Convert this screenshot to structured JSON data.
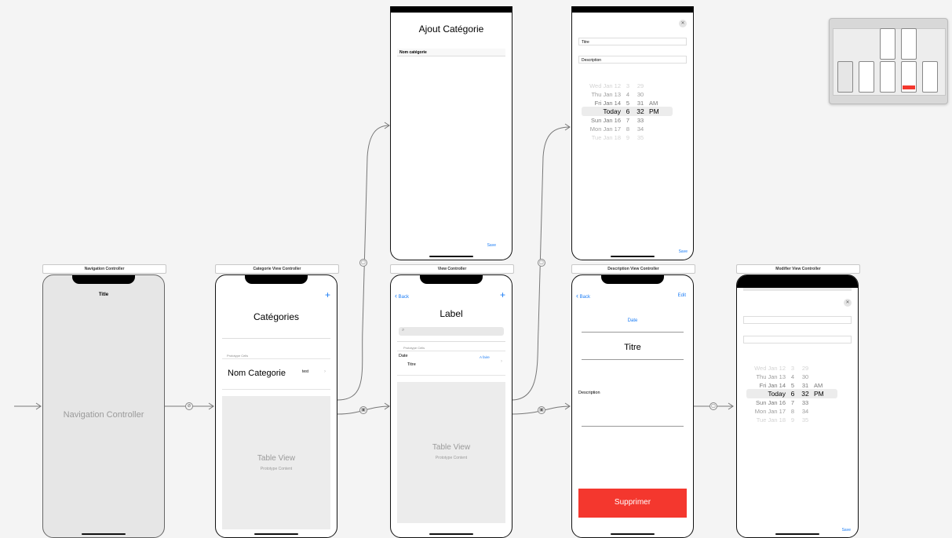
{
  "scenes": {
    "navigation": {
      "label": "Navigation Controller",
      "nav_title": "Title",
      "placeholder": "Navigation Controller"
    },
    "categories": {
      "label": "Categorie View Controller",
      "add": "+",
      "title": "Catégories",
      "prototype_header": "Prototype Cells",
      "cell_title": "Nom Categorie",
      "cell_detail": "test",
      "table_placeholder": "Table View",
      "table_sub": "Prototype Content"
    },
    "add_category": {
      "title": "Ajout Catégorie",
      "field_placeholder": "Nom catégorie",
      "save": "Save"
    },
    "view_controller": {
      "label": "View Controller",
      "back": "Back",
      "add": "+",
      "title": "Label",
      "prototype_header": "Prototype Cells",
      "cell_date": "Date",
      "cell_status": "A faire",
      "cell_title": "Titre",
      "table_placeholder": "Table View",
      "table_sub": "Prototype Content"
    },
    "add_task": {
      "field_title": "Titre",
      "field_description": "Description",
      "save": "Save"
    },
    "description": {
      "label": "Description View Controller",
      "back": "Back",
      "edit": "Edit",
      "date": "Date",
      "title": "Titre",
      "description_label": "Description",
      "delete_button": "Supprimer"
    },
    "modifier": {
      "label": "Modifier View Controller",
      "save": "Save"
    }
  },
  "date_picker": {
    "rows": [
      {
        "day": "Wed Jan 12",
        "hour": "3",
        "minute": "29",
        "period": ""
      },
      {
        "day": "Thu Jan 13",
        "hour": "4",
        "minute": "30",
        "period": ""
      },
      {
        "day": "Fri Jan 14",
        "hour": "5",
        "minute": "31",
        "period": "AM"
      },
      {
        "day": "Today",
        "hour": "6",
        "minute": "32",
        "period": "PM"
      },
      {
        "day": "Sun Jan 16",
        "hour": "7",
        "minute": "33",
        "period": ""
      },
      {
        "day": "Mon Jan 17",
        "hour": "8",
        "minute": "34",
        "period": ""
      },
      {
        "day": "Tue Jan 18",
        "hour": "9",
        "minute": "35",
        "period": ""
      }
    ],
    "selected_index": 3
  },
  "colors": {
    "accent": "#1a7cf5",
    "destructive": "#f4372e",
    "canvas": "#f4f4f4",
    "placeholder": "#ececec"
  }
}
